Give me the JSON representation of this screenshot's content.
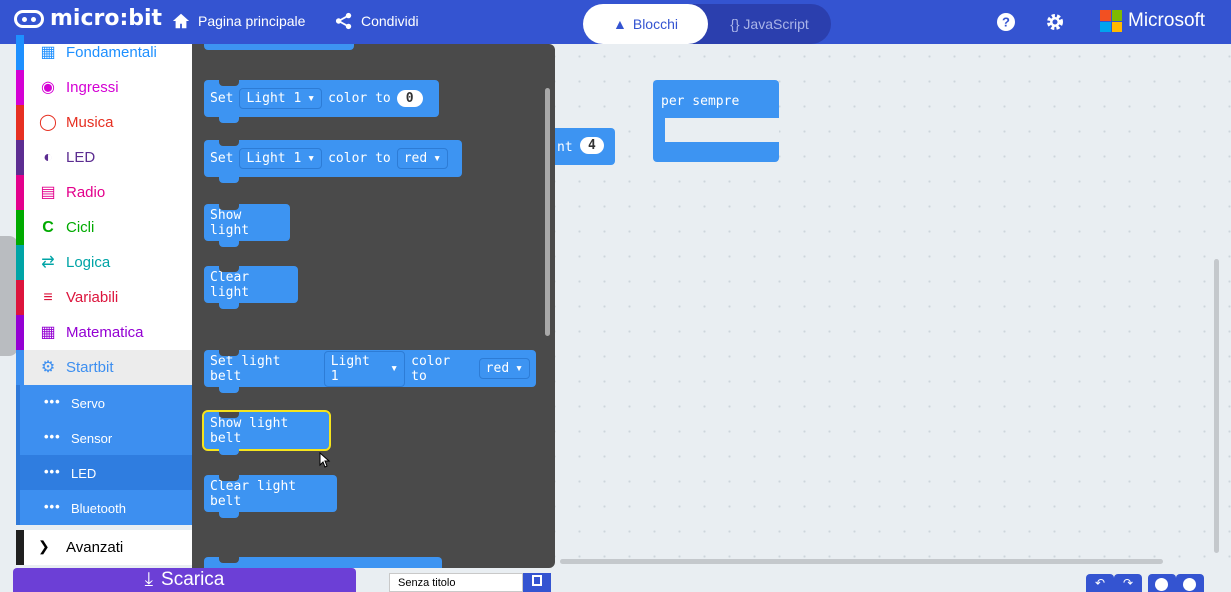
{
  "app": {
    "brand": "micro:bit"
  },
  "nav": {
    "home": "Pagina principale",
    "share": "Condividi"
  },
  "toggle": {
    "blocks": "Blocchi",
    "javascript": "{} JavaScript"
  },
  "header": {
    "microsoft": "Microsoft"
  },
  "sidebar": {
    "categories": [
      {
        "label": "Fondamentali",
        "color": "#1e90ff"
      },
      {
        "label": "Ingressi",
        "color": "#d400d4"
      },
      {
        "label": "Musica",
        "color": "#e63022"
      },
      {
        "label": "LED",
        "color": "#5c2d91"
      },
      {
        "label": "Radio",
        "color": "#e3008c"
      },
      {
        "label": "Cicli",
        "color": "#00aa00"
      },
      {
        "label": "Logica",
        "color": "#00a4a6"
      },
      {
        "label": "Variabili",
        "color": "#dc143c"
      },
      {
        "label": "Matematica",
        "color": "#9400d3"
      },
      {
        "label": "Startbit",
        "color": "#3d8ff0"
      }
    ],
    "subitems": [
      "Servo",
      "Sensor",
      "LED",
      "Bluetooth"
    ],
    "advanced": "Avanzati"
  },
  "flyout": {
    "set_light": {
      "set": "Set",
      "light": "Light 1",
      "color_to": "color to",
      "value": "0"
    },
    "set_light_red": {
      "set": "Set",
      "light": "Light 1",
      "color_to": "color to",
      "color": "red"
    },
    "show_light": "Show light",
    "clear_light": "Clear light",
    "set_light_belt": {
      "prefix": "Set light belt",
      "light": "Light 1",
      "color_to": "color to",
      "color": "red"
    },
    "show_light_belt": "Show light belt",
    "clear_light_belt": "Clear light belt"
  },
  "workspace": {
    "forever": "per sempre",
    "partial_label": "nt",
    "partial_value": "4"
  },
  "bottom": {
    "download": "Scarica",
    "filename": "Senza titolo"
  }
}
